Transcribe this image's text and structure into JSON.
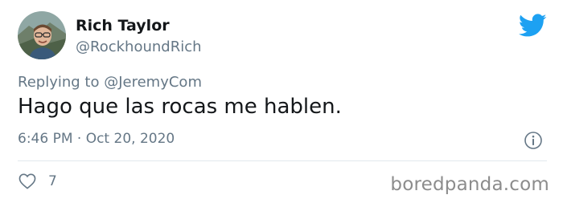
{
  "author": {
    "display_name": "Rich Taylor",
    "handle": "@RockhoundRich"
  },
  "reply": {
    "prefix": "Replying to",
    "to_handle": "@JeremyCom"
  },
  "tweet": {
    "text": "Hago que las rocas me hablen.",
    "timestamp": "6:46 PM · Oct 20, 2020"
  },
  "engagement": {
    "likes": "7"
  },
  "icons": {
    "brand": "twitter-bird-icon",
    "info": "info-icon",
    "like": "heart-icon"
  },
  "colors": {
    "twitter_blue": "#1da1f2",
    "secondary_text": "#657786",
    "primary_text": "#14171a",
    "divider": "#e1e8ed"
  },
  "watermark": "boredpanda.com"
}
